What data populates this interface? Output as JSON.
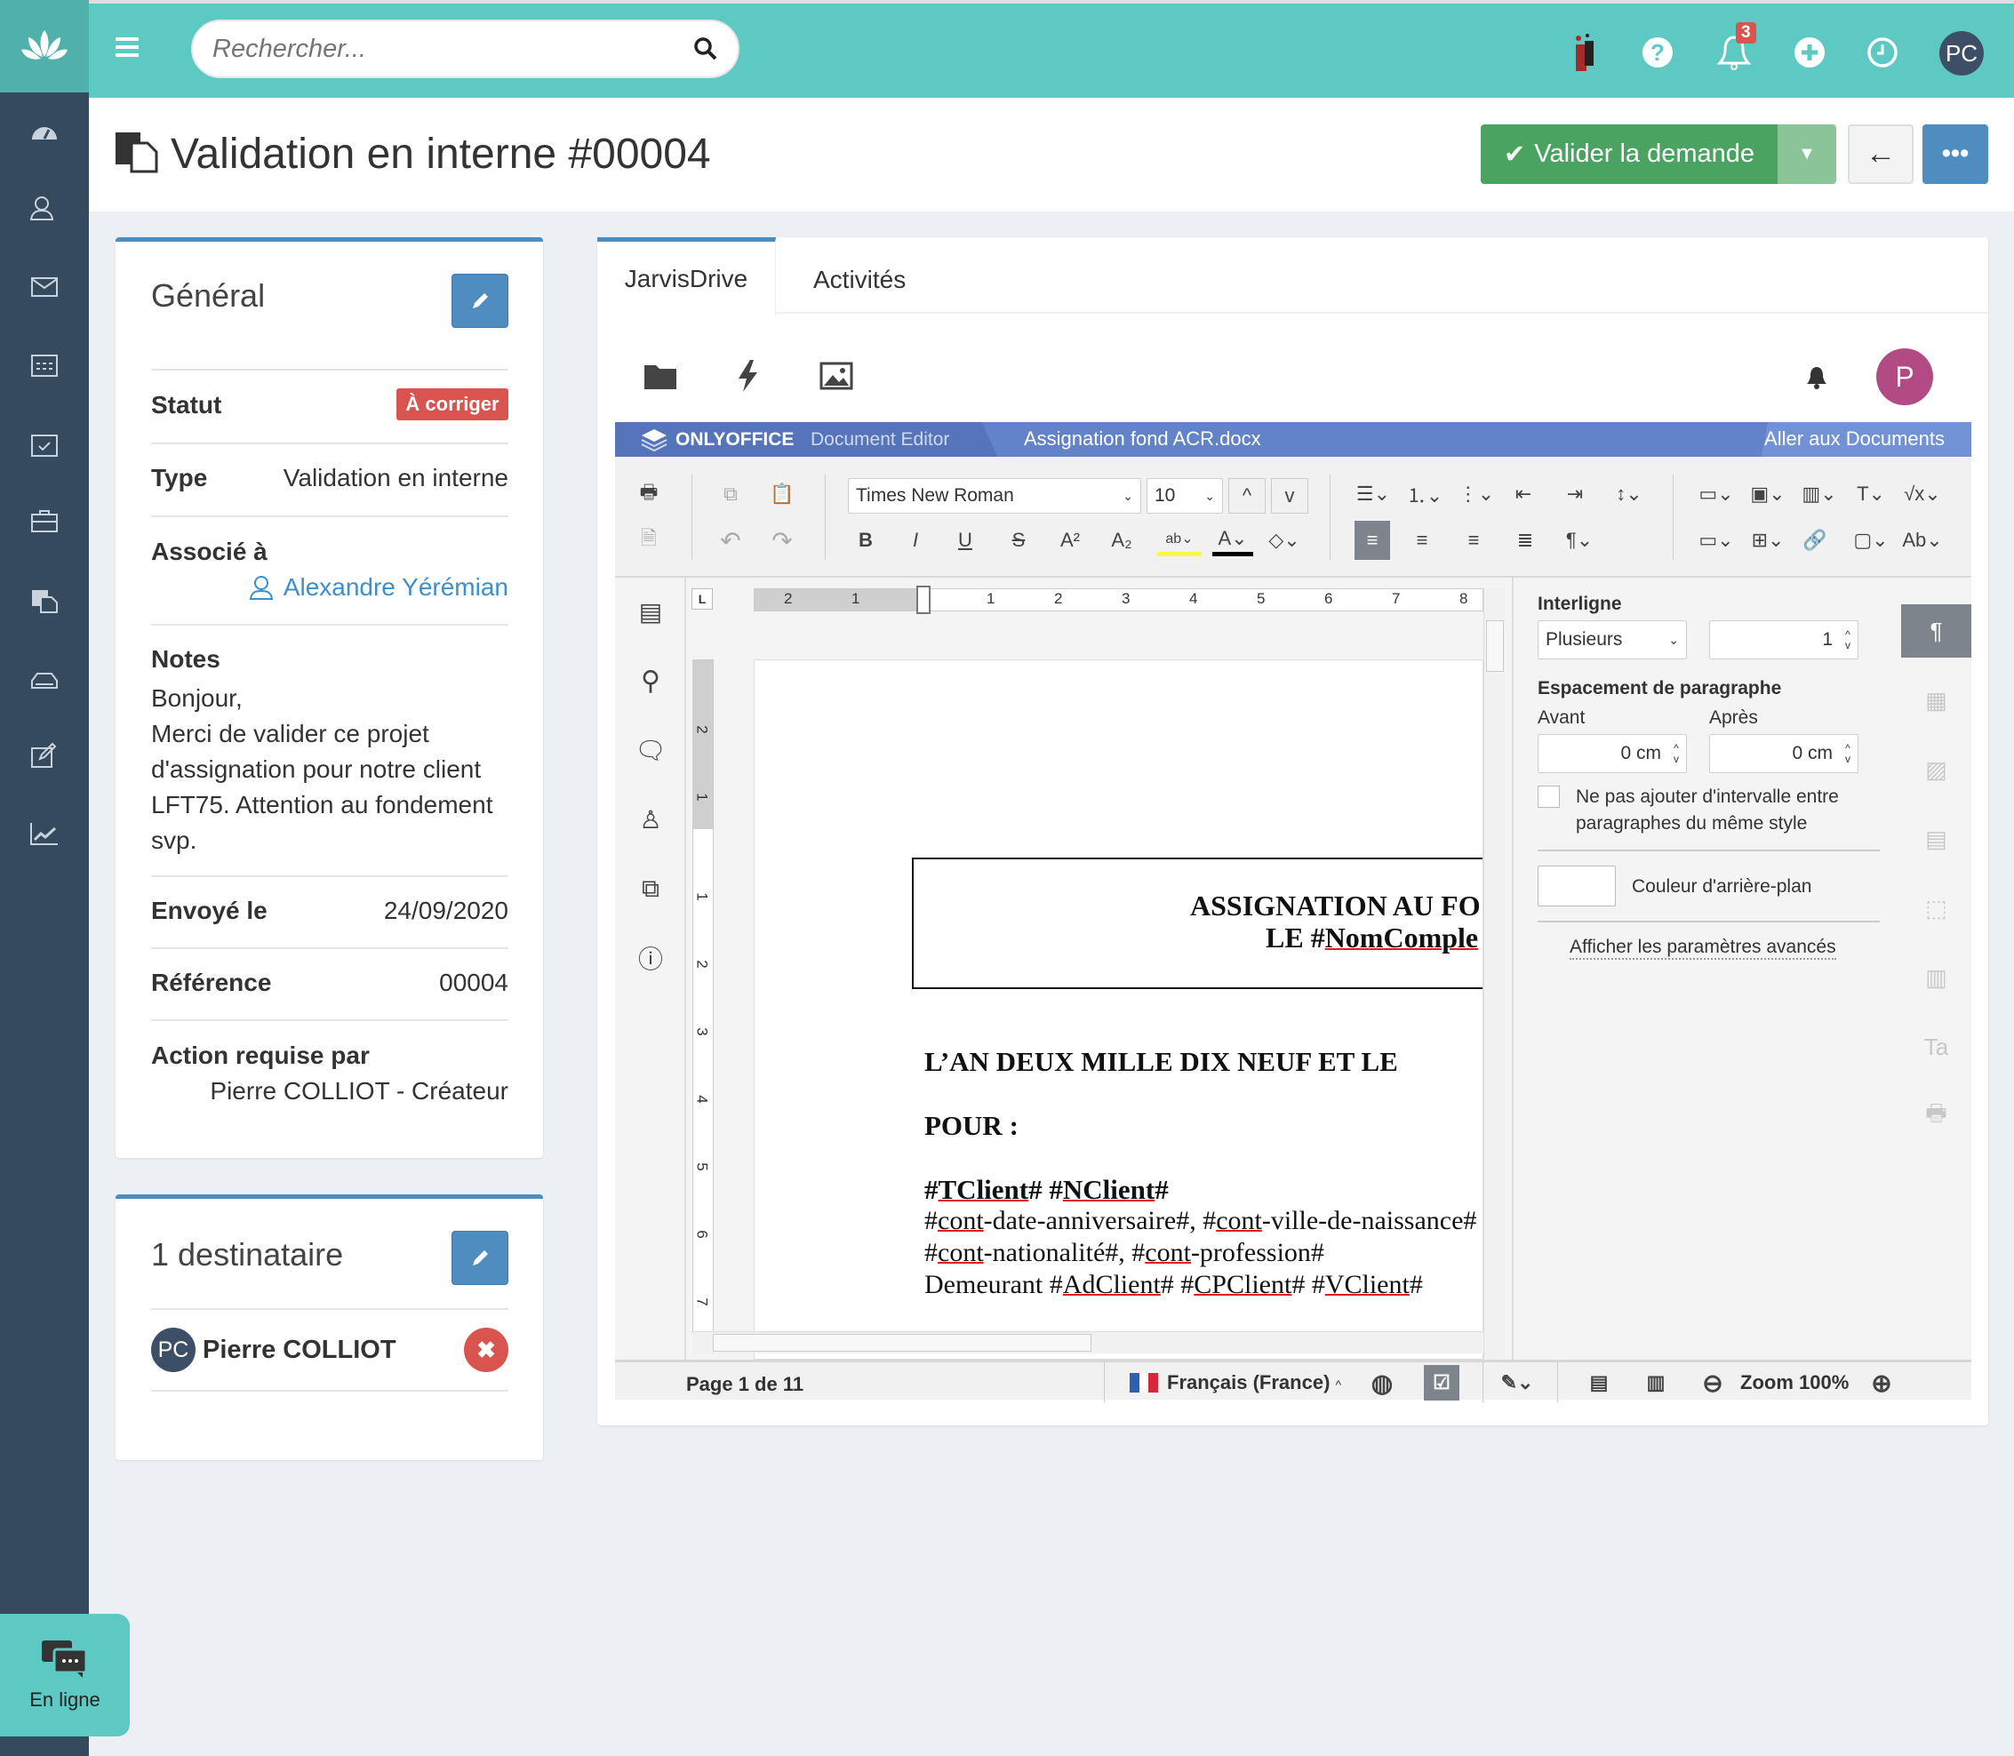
{
  "topbar": {
    "search_placeholder": "Rechercher...",
    "notification_count": "3",
    "avatar": "PC"
  },
  "sidebar": {
    "items": [
      "dashboard",
      "contacts",
      "mail",
      "calendar",
      "tasks",
      "briefcase",
      "documents",
      "inbox",
      "edit",
      "stats"
    ]
  },
  "header": {
    "title": "Validation en interne #00004",
    "validate_label": "Valider la demande"
  },
  "general": {
    "title": "Général",
    "status_label": "Statut",
    "status_value": "À corriger",
    "type_label": "Type",
    "type_value": "Validation en interne",
    "associated_label": "Associé à",
    "associated_value": "Alexandre Yérémian",
    "notes_label": "Notes",
    "notes_lines": [
      "Bonjour,",
      "Merci de valider ce projet",
      "d'assignation pour notre client",
      "LFT75. Attention au fondement",
      "svp."
    ],
    "sent_label": "Envoyé le",
    "sent_value": "24/09/2020",
    "ref_label": "Référence",
    "ref_value": "00004",
    "action_label": "Action requise par",
    "action_value": "Pierre COLLIOT - Créateur"
  },
  "recipients": {
    "title": "1 destinataire",
    "items": [
      {
        "initials": "PC",
        "name": "Pierre COLLIOT"
      }
    ]
  },
  "tabs": [
    {
      "label": "JarvisDrive",
      "active": true
    },
    {
      "label": "Activités",
      "active": false
    }
  ],
  "drive": {
    "avatar": "P"
  },
  "editor": {
    "brand": "ONLYOFFICE",
    "brand_sub": "Document Editor",
    "filename": "Assignation fond ACR.docx",
    "go_docs": "Aller aux Documents",
    "font": "Times New Roman",
    "font_size": "10",
    "ruler_h": [
      "2",
      "1",
      "1",
      "2",
      "3",
      "4",
      "5",
      "6",
      "7",
      "8"
    ],
    "ruler_v": [
      "2",
      "1",
      "1",
      "2",
      "3",
      "4",
      "5",
      "6",
      "7"
    ],
    "doc": {
      "box_line1": "ASSIGNATION AU FO",
      "box_line2_pre": "LE #",
      "box_line2_u": "NomComple",
      "line_an": "L’AN DEUX MILLE DIX NEUF ET LE",
      "line_pour": "POUR :"
    },
    "settings": {
      "line_spacing_label": "Interligne",
      "line_spacing_mode": "Plusieurs",
      "line_spacing_value": "1",
      "para_spacing_label": "Espacement de paragraphe",
      "before_label": "Avant",
      "after_label": "Après",
      "before_value": "0 cm",
      "after_value": "0 cm",
      "no_interval_line1": "Ne pas ajouter d'intervalle entre",
      "no_interval_line2": "paragraphes du même style",
      "no_interval_checked": false,
      "bg_color_label": "Couleur d'arrière-plan",
      "advanced": "Afficher les paramètres avancés"
    },
    "status": {
      "page": "Page 1 de 11",
      "language": "Français (France)",
      "zoom": "Zoom 100%"
    }
  },
  "chat": {
    "label": "En ligne"
  },
  "colors": {
    "teal": "#5ec8c2",
    "sidebar": "#364a5e",
    "primary": "#4f8dc0",
    "success": "#4ba361",
    "danger": "#d9534f",
    "onlyoffice": "#5b7fc4"
  }
}
